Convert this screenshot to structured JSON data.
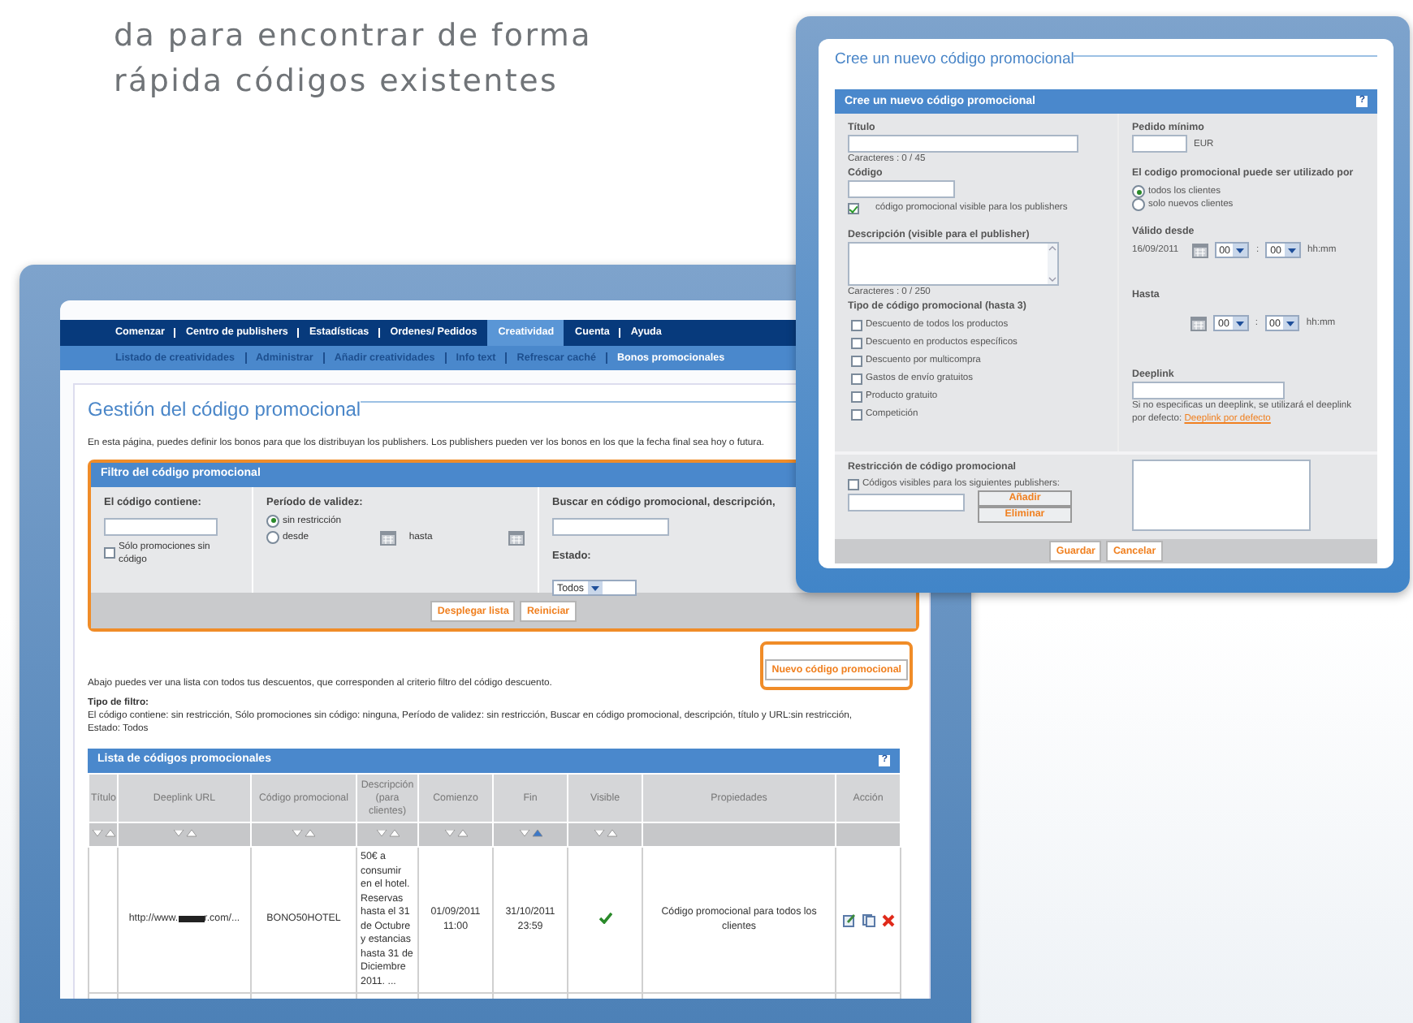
{
  "heading": [
    "da para encontrar de forma",
    "rápida códigos existentes"
  ],
  "main": {
    "nav": [
      {
        "label": "Comenzar",
        "selected": false
      },
      {
        "label": "Centro de publishers",
        "selected": false
      },
      {
        "label": "Estadísticas",
        "selected": false
      },
      {
        "label": "Ordenes/ Pedidos",
        "selected": false
      },
      {
        "label": "Creatividad",
        "selected": true
      },
      {
        "label": "Cuenta",
        "selected": false
      },
      {
        "label": "Ayuda",
        "selected": false
      }
    ],
    "subnav": [
      {
        "label": "Listado de creatividades",
        "selected": false
      },
      {
        "label": "Administrar",
        "selected": false
      },
      {
        "label": "Añadir creatividades",
        "selected": false
      },
      {
        "label": "Info text",
        "selected": false
      },
      {
        "label": "Refrescar caché",
        "selected": false
      },
      {
        "label": "Bonos promocionales",
        "selected": true
      }
    ],
    "title": "Gestión del código promocional",
    "intro": "En esta página, puedes definir los bonos para que los distribuyan los publishers. Los publishers pueden ver los bonos en los que la fecha final sea hoy o futura.",
    "filter": {
      "title": "Filtro del código promocional",
      "code_label": "El código contiene:",
      "no_code": {
        "label": "Sólo promociones sin código",
        "checked": false
      },
      "period_label": "Período de validez:",
      "period_options": [
        {
          "label": "sin restricción",
          "selected": true
        },
        {
          "label": "desde",
          "selected": false
        }
      ],
      "until_label": "hasta",
      "search_label": "Buscar en código promocional, descripción,",
      "status_label": "Estado:",
      "status_value": "Todos",
      "buttons": [
        "Desplegar lista",
        "Reiniciar"
      ]
    },
    "list_note": "Abajo puedes ver una lista con todos tus descuentos, que corresponden al criterio filtro del código descuento.",
    "new_button": "Nuevo código promocional",
    "filter_type_label": "Tipo de filtro:",
    "filter_type_text": "El código contiene: sin restricción, Sólo promociones sin código: ninguna, Período de validez: sin restricción, Buscar en código promocional, descripción, título y URL:sin restricción, Estado: Todos",
    "table": {
      "title": "Lista de códigos promocionales",
      "help": "?",
      "columns": [
        {
          "label": "Título",
          "sorted": false
        },
        {
          "label": "Deeplink URL",
          "sorted": false
        },
        {
          "label": "Código promocional",
          "sorted": false
        },
        {
          "label": "Descripción (para clientes)",
          "sorted": false
        },
        {
          "label": "Comienzo",
          "sorted": false
        },
        {
          "label": "Fin",
          "sorted": true
        },
        {
          "label": "Visible",
          "sorted": false
        },
        {
          "label": "Propiedades"
        },
        {
          "label": "Acción"
        }
      ],
      "rows": [
        {
          "url_start": "http://www.",
          "url_end": "r.com/...",
          "code": "BONO50HOTEL",
          "description": "50€ a consumir en el hotel. Reservas hasta el 31 de Octubre y estancias hasta 31 de Diciembre 2011. ...",
          "start": "01/09/2011 11:00",
          "end": "31/10/2011 23:59",
          "visible": true,
          "properties": "Código promocional para todos los clientes"
        }
      ]
    }
  },
  "dialog": {
    "title": "Cree un nuevo código promocional",
    "bar_title": "Cree un nuevo código promocional",
    "help": "?",
    "title_label": "Título",
    "title_count": "Caracteres : 0  /  45",
    "code_label": "Código",
    "visible_publishers": {
      "label": "código promocional visible para los publishers",
      "checked": true
    },
    "description_label": "Descripción (visible para el publisher)",
    "description_count": "Caracteres : 0  /  250",
    "type_label": "Tipo de código promocional (hasta 3)",
    "types": [
      {
        "label": "Descuento de todos los productos",
        "checked": false
      },
      {
        "label": "Descuento en productos específicos",
        "checked": false
      },
      {
        "label": "Descuento por multicompra",
        "checked": false
      },
      {
        "label": "Gastos de envío gratuitos",
        "checked": false
      },
      {
        "label": "Producto gratuito",
        "checked": false
      },
      {
        "label": "Competición",
        "checked": false
      }
    ],
    "min_order_label": "Pedido mínimo",
    "currency": "EUR",
    "usable_label": "El codigo promocional puede ser utilizado por",
    "usable_options": [
      {
        "label": "todos los clientes",
        "selected": true
      },
      {
        "label": "solo nuevos clientes",
        "selected": false
      }
    ],
    "from_label": "Válido desde",
    "from_date": "16/09/2011",
    "from_hour": "00",
    "from_minute": "00",
    "time_sep": ":",
    "time_format": "hh:mm",
    "until_label": "Hasta",
    "until_hour": "00",
    "until_minute": "00",
    "until_time_sep": ":",
    "until_time_format": "hh:mm",
    "deeplink_label": "Deeplink",
    "deeplink_note": "Si no especificas un deeplink, se utilizará el deeplink por defecto:",
    "deeplink_link": "Deeplink por defecto",
    "restriction_label": "Restricción de código promocional",
    "restriction_check": {
      "label": "Códigos visibles para los siguientes publishers:",
      "checked": false
    },
    "list_buttons": [
      "Añadir",
      "Eliminar"
    ],
    "buttons": [
      "Guardar",
      "Cancelar"
    ]
  }
}
